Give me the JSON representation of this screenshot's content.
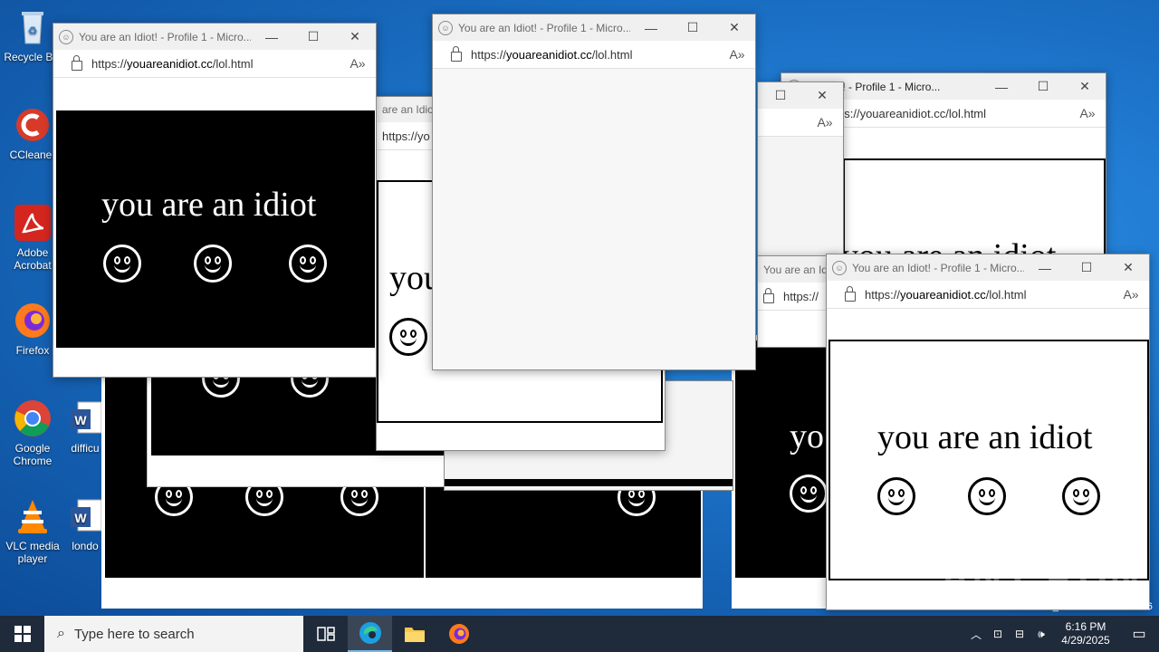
{
  "desktop": {
    "icons": [
      {
        "label": "Recycle Bin",
        "icon": "recycle-bin-icon"
      },
      {
        "label": "CCleaner",
        "icon": "ccleaner-icon"
      },
      {
        "label": "Adobe Acrobat",
        "icon": "acrobat-icon"
      },
      {
        "label": "Firefox",
        "icon": "firefox-icon"
      },
      {
        "label": "Google Chrome",
        "icon": "chrome-icon"
      },
      {
        "label": "VLC media player",
        "icon": "vlc-icon"
      },
      {
        "label": "difficu",
        "icon": "word-doc-icon"
      },
      {
        "label": "londo",
        "icon": "word-doc-icon"
      }
    ],
    "watermark": "ANY RUN",
    "build_text": "Build 19041.vb_release.191206-1406"
  },
  "browser": {
    "title": "You are an Idiot! - Profile 1 - Micro...",
    "title_partial_1": "are an Idiot",
    "title_partial_2": "an Idiot! - Profile 1 - Micro...",
    "title_partial_3": "You are an Id",
    "url_prefix": "https://",
    "url_domain": "youareanidiot.cc",
    "url_path": "/lol.html",
    "url_partial_1": "https://yo",
    "url_partial_2": "ps://youareanidiot.cc/lol.html",
    "url_partial_3": "https://",
    "minimize": "—",
    "maximize": "☐",
    "close": "✕",
    "read_aloud": "A»"
  },
  "content": {
    "message": "you are an idiot",
    "partial_1": "you",
    "partial_2": "you are an idiot",
    "partial_3": "yo"
  },
  "taskbar": {
    "search_placeholder": "Type here to search",
    "time": "6:16 PM",
    "date": "4/29/2025"
  },
  "colors": {
    "accent": "#0078d4",
    "taskbar": "#1f2a3a",
    "desktop": "#1a6fc4"
  }
}
